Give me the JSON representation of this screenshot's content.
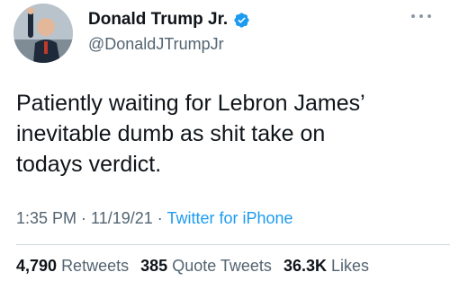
{
  "author": {
    "display_name": "Donald Trump Jr.",
    "handle": "@DonaldJTrumpJr",
    "verified": true
  },
  "tweet": {
    "lines": [
      "Patiently waiting for Lebron James’",
      "inevitable dumb as shit take on",
      "todays verdict."
    ]
  },
  "meta": {
    "time": "1:35 PM",
    "sep1": " · ",
    "date": "11/19/21",
    "sep2": " · ",
    "source": "Twitter for iPhone"
  },
  "stats": {
    "retweets_count": "4,790",
    "retweets_label": "Retweets",
    "quotes_count": "385",
    "quotes_label": "Quote Tweets",
    "likes_count": "36.3K",
    "likes_label": "Likes"
  },
  "colors": {
    "text": "#0f1419",
    "secondary": "#536471",
    "link": "#1d9bf0",
    "verified": "#1d9bf0"
  },
  "icons": {
    "more": "more-icon",
    "verified": "verified-badge-icon"
  }
}
